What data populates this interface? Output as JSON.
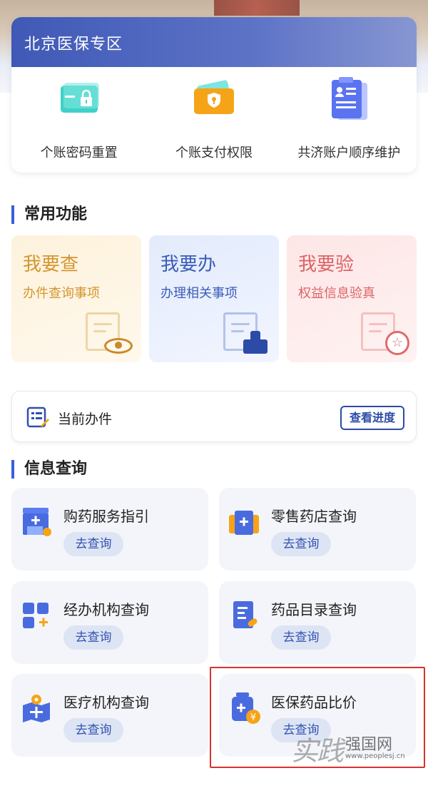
{
  "zone": {
    "title": "北京医保专区",
    "items": [
      {
        "label": "个账密码重置",
        "icon": "password-card-icon"
      },
      {
        "label": "个账支付权限",
        "icon": "payment-shield-icon"
      },
      {
        "label": "共济账户顺序维护",
        "icon": "account-document-icon"
      }
    ]
  },
  "common": {
    "title": "常用功能",
    "cards": [
      {
        "title": "我要查",
        "sub": "办件查询事项",
        "icon": "document-eye-icon"
      },
      {
        "title": "我要办",
        "sub": "办理相关事项",
        "icon": "document-stamp-icon"
      },
      {
        "title": "我要验",
        "sub": "权益信息验真",
        "icon": "document-star-icon"
      }
    ]
  },
  "current": {
    "label": "当前办件",
    "button": "查看进度",
    "icon": "clipboard-pen-icon"
  },
  "info": {
    "title": "信息查询",
    "cards": [
      {
        "title": "购药服务指引",
        "button": "去查询",
        "icon": "pharmacy-store-icon"
      },
      {
        "title": "零售药店查询",
        "button": "去查询",
        "icon": "medical-box-icon"
      },
      {
        "title": "经办机构查询",
        "button": "去查询",
        "icon": "grid-plus-icon"
      },
      {
        "title": "药品目录查询",
        "button": "去查询",
        "icon": "drug-list-icon"
      },
      {
        "title": "医疗机构查询",
        "button": "去查询",
        "icon": "hospital-map-icon"
      },
      {
        "title": "医保药品比价",
        "button": "去查询",
        "icon": "medicine-price-icon"
      }
    ]
  },
  "watermark": {
    "big": "实践",
    "site": "强国网",
    "url": "www.peoplesj.cn"
  },
  "colors": {
    "primary": "#2b4ba6",
    "accent_blue": "#3a5fd9",
    "highlight_red": "#d7322e"
  }
}
